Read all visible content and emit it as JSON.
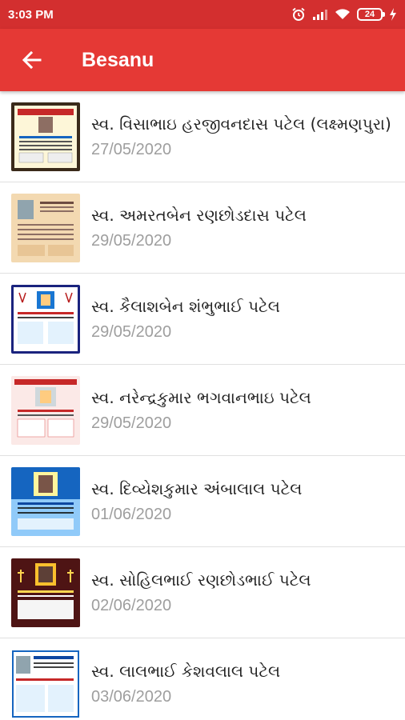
{
  "status_bar": {
    "time": "3:03 PM",
    "battery": "24",
    "icons": [
      "alarm-icon",
      "signal-icon",
      "wifi-icon",
      "battery-icon",
      "charging-icon"
    ]
  },
  "app_bar": {
    "title": "Besanu",
    "back_icon": "arrow-left-icon",
    "color": "#e53935"
  },
  "list": {
    "items": [
      {
        "title": "સ્વ. વિસાભાઇ હરજીવનદાસ પટેલ (લક્ષ્મણપુરા)",
        "date": "27/05/2020",
        "thumb_style": "yellow"
      },
      {
        "title": "સ્વ. અમરતબેન રણછોડદાસ પટેલ",
        "date": "29/05/2020",
        "thumb_style": "peach"
      },
      {
        "title": "સ્વ. કૈલાશબેન શંભુભાઈ પટેલ",
        "date": "29/05/2020",
        "thumb_style": "white-blue"
      },
      {
        "title": "સ્વ. નરેન્દ્રકુમાર ભગવાનભાઇ પટેલ",
        "date": "29/05/2020",
        "thumb_style": "white-red"
      },
      {
        "title": "સ્વ. દિવ્યેશકુમાર અંબાલાલ પટેલ",
        "date": "01/06/2020",
        "thumb_style": "blue"
      },
      {
        "title": "સ્વ. સોહિલભાઈ રણછોડભાઈ પટેલ",
        "date": "02/06/2020",
        "thumb_style": "maroon"
      },
      {
        "title": "સ્વ. લાલભાઈ કેશવલાલ પટેલ",
        "date": "03/06/2020",
        "thumb_style": "white-blue"
      }
    ]
  }
}
